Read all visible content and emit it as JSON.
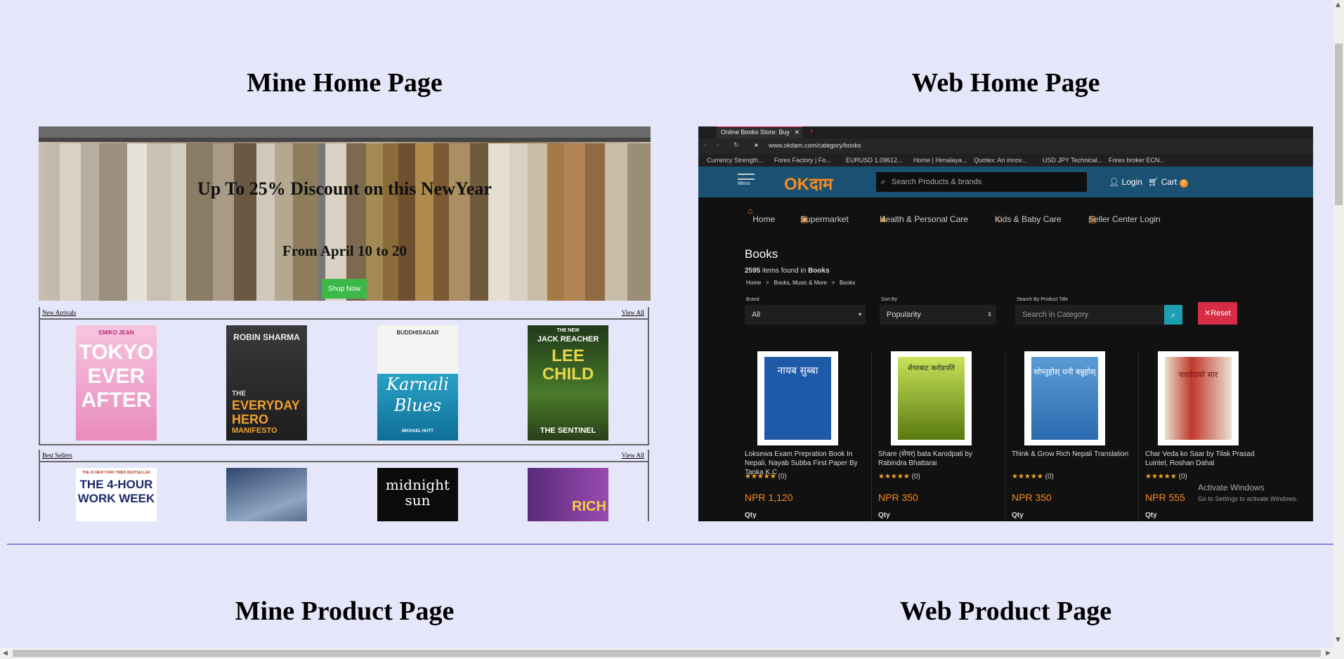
{
  "titles": {
    "mine_home": "Mine Home Page",
    "web_home": "Web Home Page",
    "mine_product": "Mine Product Page",
    "web_product": "Web Product Page"
  },
  "mine_home": {
    "hero_line1": "Up To 25% Discount on this NewYear",
    "hero_line2": "From April 10 to 20",
    "shop_button": "Shop Now",
    "new_arrivals": {
      "label": "New Arrivals",
      "view_all": "View All",
      "books": [
        {
          "line1": "EMIKO JEAN",
          "line2": "TOKYO",
          "line3": "EVER",
          "line4": "AFTER"
        },
        {
          "line1": "ROBIN SHARMA",
          "line2": "THE",
          "line3": "EVERYDAY",
          "line4": "HERO",
          "line5": "MANIFESTO"
        },
        {
          "line1": "BUDDHISAGAR",
          "line2": "Karnali",
          "line3": "Blues",
          "line4": "MICHAEL HUTT"
        },
        {
          "line1": "THE NEW",
          "line2": "JACK REACHER",
          "line3": "LEE",
          "line4": "CHILD",
          "line5": "THE SENTINEL"
        }
      ]
    },
    "best_sellers": {
      "label": "Best Sellers",
      "view_all": "View All",
      "books": [
        {
          "line1": "THE #1 NEW YORK TIMES BESTSELLER",
          "line2": "THE 4-HOUR",
          "line3": "WORK WEEK"
        },
        {
          "line1": ""
        },
        {
          "line1": "midnight",
          "line2": "sun"
        },
        {
          "line1": "RICH"
        }
      ]
    }
  },
  "web_home": {
    "tab_title": "Online Books Store: Buy",
    "url": "www.okdam.com/category/books",
    "bookmarks": [
      "Currency Strength...",
      "Forex Factory | Fo...",
      "EURUSD 1.09612...",
      "Home | Himalaya...",
      "Quotex: An innov...",
      "USD JPY Technical...",
      "Forex broker ECN..."
    ],
    "menu_label": "Menu",
    "logo": "OKदाम",
    "search_placeholder": "Search Products & brands",
    "login": "Login",
    "cart": "Cart",
    "cart_count": "0",
    "nav": [
      "Home",
      "Supermarket",
      "Health & Personal Care",
      "Kids & Baby Care",
      "Seller Center Login"
    ],
    "heading": "Books",
    "count_number": "2595",
    "count_text": "items found in",
    "count_category": "Books",
    "breadcrumb": [
      "Home",
      ">",
      "Books, Music & More",
      ">",
      "Books"
    ],
    "filters": {
      "brand_label": "Brand",
      "brand_value": "All",
      "sort_label": "Sort By",
      "sort_value": "Popularity",
      "search_label": "Search By Product Title",
      "search_placeholder": "Search in Category",
      "reset": "Reset"
    },
    "products": [
      {
        "name": "Loksewa Exam Prepration Book In Nepali, Nayab Subba First Paper By Tanka K.C",
        "rating": "★★★★★",
        "reviews": "(0)",
        "price": "NPR 1,120",
        "qty": "Qty",
        "cover_color": "#1e5aa8",
        "cover_text": "नायब सुब्बा"
      },
      {
        "name": "Share (शेयर) bata Karodpati by Rabindra Bhattarai",
        "rating": "★★★★★",
        "reviews": "(0)",
        "price": "NPR 350",
        "qty": "Qty",
        "cover_color": "#6f9a1a",
        "cover_text": "शेयरबाट करोडपति"
      },
      {
        "name": "Think & Grow Rich Nepali Translation",
        "rating": "★★★★★",
        "reviews": "(0)",
        "price": "NPR 350",
        "qty": "Qty",
        "cover_color": "#2b6cb0",
        "cover_text": "सोच्नुहोस् धनी बन्नुहोस्"
      },
      {
        "name": "Char Veda ko Saar by Tilak Prasad Luintel, Roshan Dahal",
        "rating": "★★★★★",
        "reviews": "(0)",
        "price": "NPR 555",
        "qty": "Qty",
        "cover_color": "#c0392b",
        "cover_text": "चारवेदको सार"
      }
    ],
    "watermark_title": "Activate Windows",
    "watermark_sub": "Go to Settings to activate Windows."
  }
}
